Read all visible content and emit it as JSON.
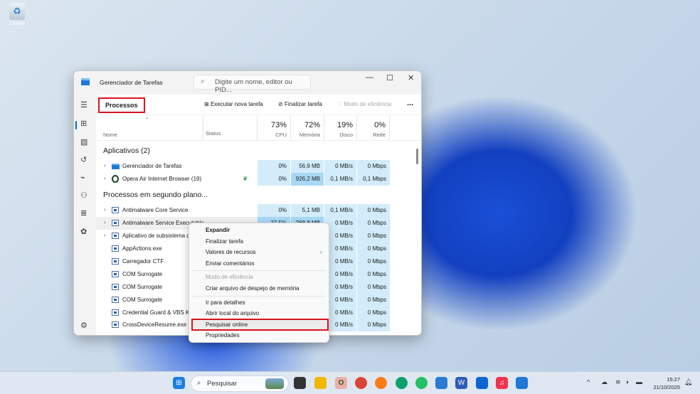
{
  "desktop": {
    "recycle_bin": "Lixeira"
  },
  "window": {
    "title": "Gerenciador de Tarefas",
    "search_placeholder": "Digite um nome, editor ou PID..."
  },
  "command_bar": {
    "page": "Processos",
    "run_task": "Executar nova tarefa",
    "end_task": "Finalizar tarefa",
    "efficiency": "Modo de eficiência",
    "more": "..."
  },
  "columns": {
    "name": "Nome",
    "status": "Status",
    "cpu": {
      "pct": "73%",
      "label": "CPU"
    },
    "mem": {
      "pct": "72%",
      "label": "Memória"
    },
    "disk": {
      "pct": "19%",
      "label": "Disco"
    },
    "net": {
      "pct": "0%",
      "label": "Rede"
    }
  },
  "groups": {
    "apps": "Aplicativos (2)",
    "background": "Processos em segundo plano..."
  },
  "rows": [
    {
      "name": "Gerenciador de Tarefas",
      "cpu": "0%",
      "mem": "56,9 MB",
      "disk": "0 MB/s",
      "net": "0 Mbps"
    },
    {
      "name": "Opera Air Internet Browser (19)",
      "cpu": "0%",
      "mem": "926,2 MB",
      "disk": "0,1 MB/s",
      "net": "0,1 Mbps"
    },
    {
      "name": "Antimalware Core Service",
      "cpu": "0%",
      "mem": "5,1 MB",
      "disk": "0,1 MB/s",
      "net": "0 Mbps"
    },
    {
      "name": "Antimalware Service Executable",
      "cpu": "27,5%",
      "mem": "268,8 MB",
      "disk": "0 MB/s",
      "net": "0 Mbps"
    },
    {
      "name": "Aplicativo de subsistema de",
      "cpu": "",
      "mem": "",
      "disk": "0 MB/s",
      "net": "0 Mbps"
    },
    {
      "name": "AppActions.exe",
      "cpu": "",
      "mem": "",
      "disk": "0 MB/s",
      "net": "0 Mbps"
    },
    {
      "name": "Carregador CTF",
      "cpu": "",
      "mem": "",
      "disk": "0 MB/s",
      "net": "0 Mbps"
    },
    {
      "name": "COM Surrogate",
      "cpu": "",
      "mem": "",
      "disk": "0 MB/s",
      "net": "0 Mbps"
    },
    {
      "name": "COM Surrogate",
      "cpu": "",
      "mem": "",
      "disk": "0 MB/s",
      "net": "0 Mbps"
    },
    {
      "name": "COM Surrogate",
      "cpu": "",
      "mem": "",
      "disk": "0 MB/s",
      "net": "0 Mbps"
    },
    {
      "name": "Credential Guard & VBS Key",
      "cpu": "",
      "mem": "",
      "disk": "0 MB/s",
      "net": "0 Mbps"
    },
    {
      "name": "CrossDeviceResume.exe",
      "cpu": "",
      "mem": "",
      "disk": "0 MB/s",
      "net": "0 Mbps"
    }
  ],
  "context_menu": {
    "items": [
      "Expandir",
      "Finalizar tarefa",
      "Valores de recursos",
      "Enviar comentários",
      "Modo de eficiência",
      "Criar arquivo de despejo de memória",
      "Ir para detalhes",
      "Abrir local do arquivo",
      "Pesquisar online",
      "Propriedades"
    ]
  },
  "taskbar": {
    "search": "Pesquisar",
    "time": "15:27",
    "date": "21/10/2025"
  }
}
